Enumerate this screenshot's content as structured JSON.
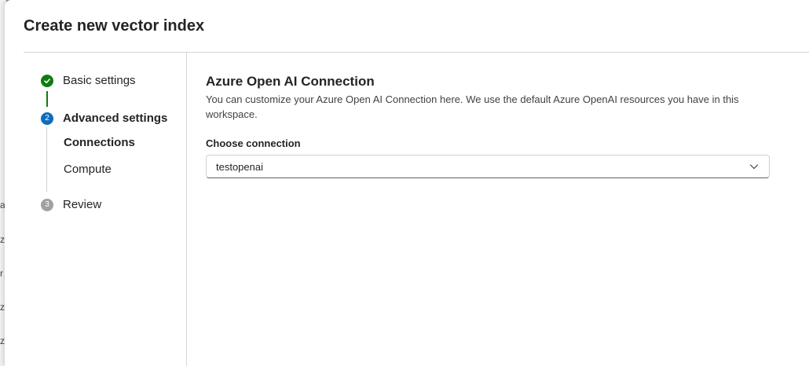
{
  "background": {
    "glyphs": [
      "a",
      "z",
      "r",
      "z",
      "z"
    ]
  },
  "dialog": {
    "title": "Create new vector index"
  },
  "stepper": {
    "steps": [
      {
        "label": "Basic settings",
        "state": "completed",
        "icon": "check-icon"
      },
      {
        "label": "Advanced settings",
        "number": "2",
        "state": "active",
        "substeps": [
          {
            "label": "Connections",
            "active": true
          },
          {
            "label": "Compute",
            "active": false
          }
        ]
      },
      {
        "label": "Review",
        "number": "3",
        "state": "pending"
      }
    ]
  },
  "content": {
    "title": "Azure Open AI Connection",
    "description": "You can customize your Azure Open AI Connection here. We use the default Azure OpenAI resources you have in this workspace.",
    "connection_label": "Choose connection",
    "connection_value": "testopenai",
    "chevron_icon": "chevron-down-icon"
  },
  "colors": {
    "completed": "#107c10",
    "active": "#0f6cbd",
    "pending": "#a0a0a0"
  }
}
